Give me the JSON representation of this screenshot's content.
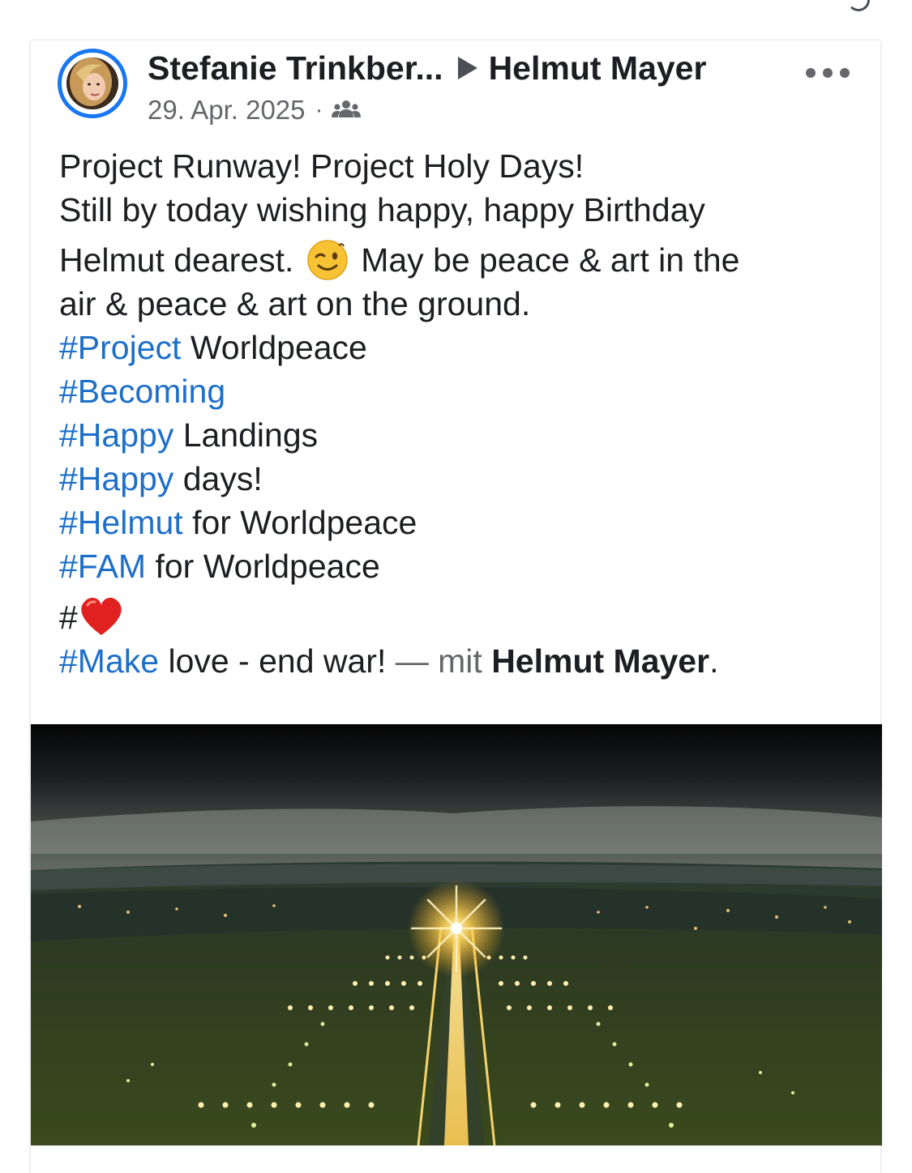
{
  "post": {
    "author": "Stefanie Trinkber...",
    "target": "Helmut Mayer",
    "date": "29. Apr. 2025",
    "meta_separator": "·",
    "audience_icon": "friends-group-icon",
    "more_icon": "more-options-icon"
  },
  "text": {
    "line1": "Project Runway! Project Holy Days!",
    "line2": "Still by today wishing happy, happy Birthday",
    "line3_a": "Helmut dearest.",
    "line3_emoji": "winking-face-emoji",
    "line3_b": "May be peace & art in the",
    "line4": "air & peace & art on the ground.",
    "tag1": "#Project",
    "tag1_rest": " Worldpeace",
    "tag2": "#Becoming",
    "tag3": "#Happy",
    "tag3_rest": " Landings",
    "tag4": "#Happy",
    "tag4_rest": " days!",
    "tag5": "#Helmut",
    "tag5_rest": " for Worldpeace",
    "tag6": "#FAM",
    "tag6_rest": " for Worldpeace",
    "heart_prefix": "#",
    "heart_emoji": "red-heart-emoji",
    "tag7": "#Make",
    "tag7_rest": " love - end war!",
    "with_text": " — mit ",
    "with_name": "Helmut Mayer",
    "final_dot": "."
  },
  "image": {
    "description_icon": "runway-night-photo"
  },
  "colors": {
    "accent": "#1877f2",
    "hashtag": "#1d6fc9",
    "text": "#1c1e21",
    "secondary": "#65676b",
    "heart": "#e0211f",
    "emoji": "#f7c234"
  }
}
